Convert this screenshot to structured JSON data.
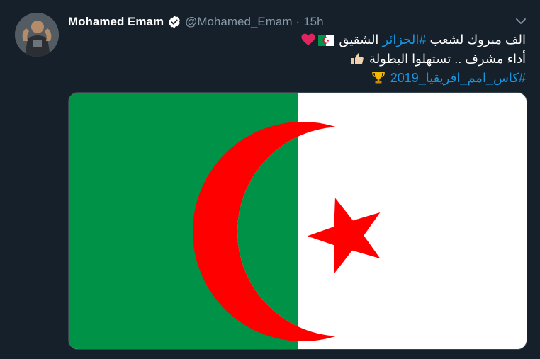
{
  "tweet": {
    "author_name": "Mohamed Emam",
    "handle": "@Mohamed_Emam",
    "separator": "·",
    "time": "15h",
    "lines": [
      {
        "before": "الف مبروك لشعب ",
        "hashtag": "#الجزائر",
        "after": " الشقيق",
        "emojis": [
          "algeria-flag",
          "red-heart"
        ]
      },
      {
        "text": "أداء مشرف .. تستهلوا البطولة",
        "emojis": [
          "thumbs-up"
        ]
      },
      {
        "hashtag": "#كاس_امم_افريقيا_2019",
        "emojis": [
          "trophy"
        ]
      }
    ]
  },
  "icons": {
    "verified": "verified-badge-icon",
    "menu": "chevron-down-icon"
  },
  "colors": {
    "background": "#15202b",
    "text": "#ffffff",
    "muted": "#8899a6",
    "link": "#1b95e0",
    "flag_green": "#009246",
    "flag_white": "#ffffff",
    "flag_red": "#ff0000"
  }
}
